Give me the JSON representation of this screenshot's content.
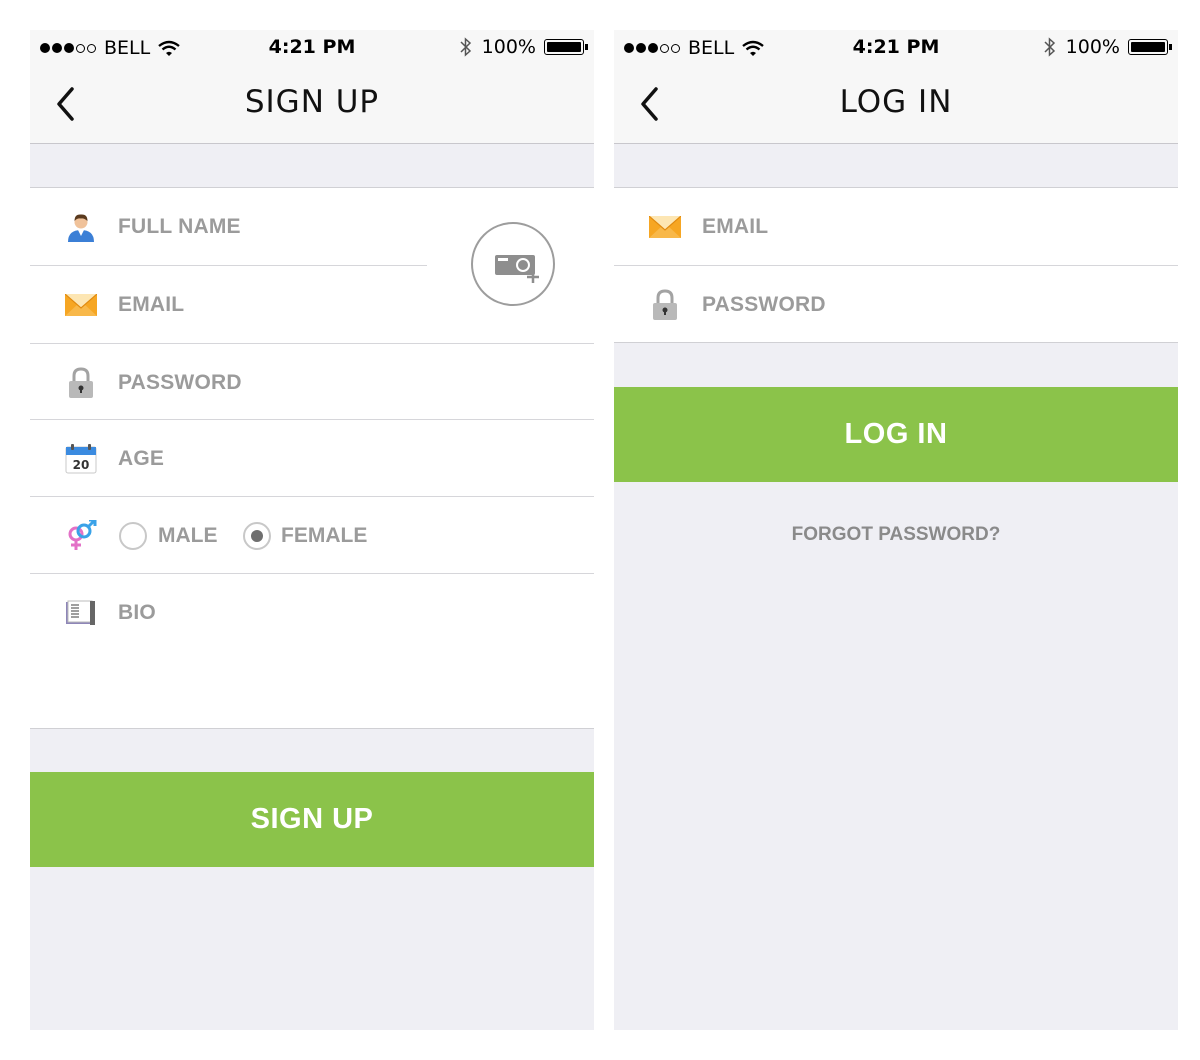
{
  "status_bar": {
    "carrier": "BELL",
    "time": "4:21 PM",
    "battery": "100%"
  },
  "signup": {
    "title": "SIGN UP",
    "fields": {
      "full_name": "FULL NAME",
      "email": "EMAIL",
      "password": "PASSWORD",
      "age": "AGE",
      "bio": "BIO"
    },
    "gender": {
      "male": "MALE",
      "female": "FEMALE",
      "selected": "FEMALE"
    },
    "calendar_day": "20",
    "button": "SIGN UP"
  },
  "login": {
    "title": "LOG IN",
    "fields": {
      "email": "EMAIL",
      "password": "PASSWORD"
    },
    "button": "LOG IN",
    "forgot": "FORGOT PASSWORD?"
  },
  "colors": {
    "accent": "#8bc34a",
    "background": "#efeff4"
  },
  "icons": [
    "signal-dots-icon",
    "wifi-icon",
    "bluetooth-icon",
    "battery-icon",
    "back-chevron-icon",
    "user-icon",
    "envelope-icon",
    "lock-icon",
    "calendar-icon",
    "gender-icon",
    "book-icon",
    "camera-add-icon"
  ]
}
